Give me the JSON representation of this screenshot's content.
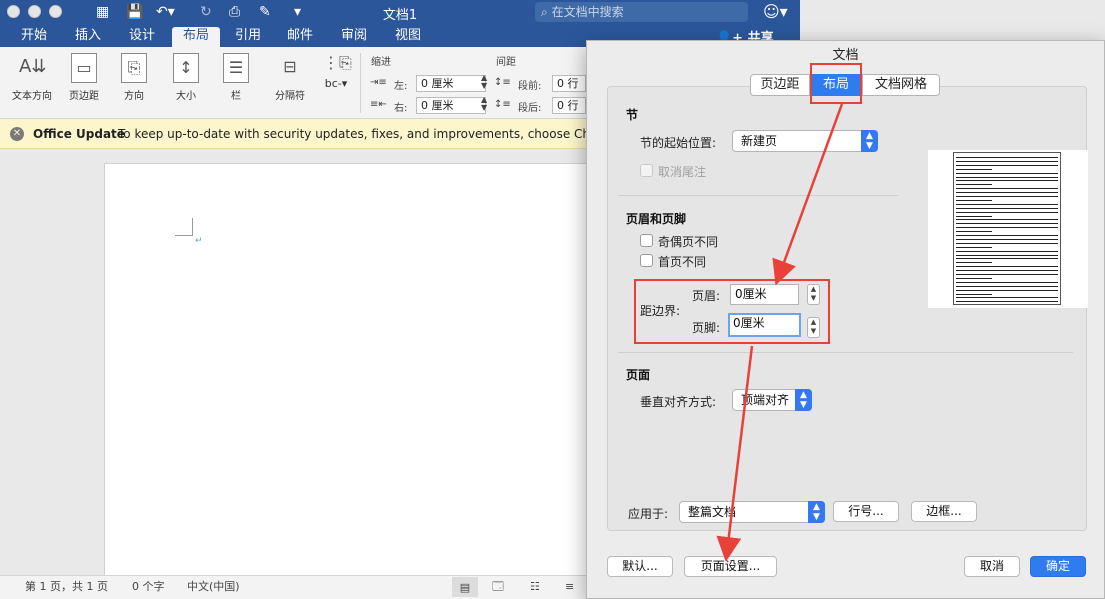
{
  "window": {
    "title": "文档1",
    "search_placeholder": "在文档中搜索"
  },
  "ribbon_tabs": [
    "开始",
    "插入",
    "设计",
    "布局",
    "引用",
    "邮件",
    "审阅",
    "视图"
  ],
  "ribbon_active_tab": "布局",
  "share_label": "共享",
  "ribbon": {
    "buttons": [
      "文本方向",
      "页边距",
      "方向",
      "大小",
      "栏",
      "分隔符"
    ],
    "indent_group": "缩进",
    "spacing_group": "间距",
    "indent_left_label": "左:",
    "indent_right_label": "右:",
    "indent_left_value": "0 厘米",
    "indent_right_value": "0 厘米",
    "space_before_label": "段前:",
    "space_after_label": "段后:",
    "space_before_value": "0 行",
    "space_after_value": "0 行"
  },
  "update_bar": {
    "title": "Office Update",
    "message": "To keep up-to-date with security updates, fixes, and improvements, choose Check for U"
  },
  "status_bar": {
    "page": "第 1 页，共 1 页",
    "words": "0 个字",
    "language": "中文(中国)"
  },
  "dialog": {
    "title": "文档",
    "tabs": [
      "页边距",
      "布局",
      "文档网格"
    ],
    "active_tab": "布局",
    "section": {
      "title": "节",
      "start_label": "节的起始位置:",
      "start_value": "新建页",
      "suppress_endnotes": "取消尾注"
    },
    "header_footer": {
      "title": "页眉和页脚",
      "odd_even": "奇偶页不同",
      "first_page": "首页不同",
      "from_edge_label": "距边界:",
      "header_label": "页眉:",
      "header_value": "0厘米",
      "footer_label": "页脚:",
      "footer_value": "0厘米"
    },
    "page": {
      "title": "页面",
      "valign_label": "垂直对齐方式:",
      "valign_value": "顶端对齐"
    },
    "apply_label": "应用于:",
    "apply_value": "整篇文档",
    "line_numbers_button": "行号...",
    "borders_button": "边框...",
    "default_button": "默认...",
    "page_setup_button": "页面设置...",
    "cancel_button": "取消",
    "ok_button": "确定"
  },
  "colors": {
    "word_blue": "#2b579a",
    "accent_blue": "#2f7bf0",
    "annotation_red": "#e8413a"
  }
}
